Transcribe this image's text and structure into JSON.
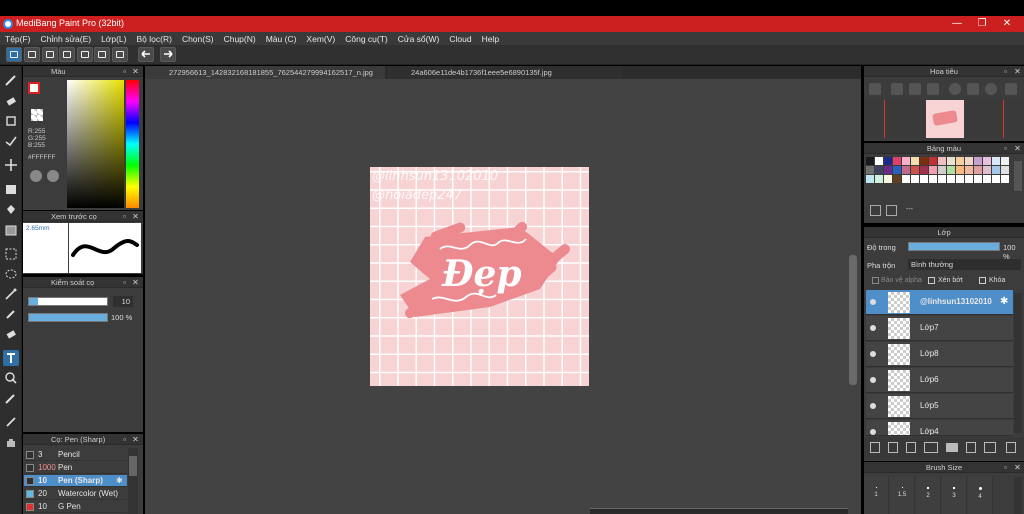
{
  "window": {
    "title": "MediBang Paint Pro (32bit)",
    "min": "—",
    "restore": "❐",
    "close": "✕"
  },
  "menu": [
    "Tệp(F)",
    "Chỉnh sửa(E)",
    "Lớp(L)",
    "Bộ lọc(R)",
    "Chọn(S)",
    "Chụp(N)",
    "Màu (C)",
    "Xem(V)",
    "Công cụ(T)",
    "Cửa sổ(W)",
    "Cloud",
    "Help"
  ],
  "tabs": [
    "272956613_1428321681818​55_762544279994162517_n.jpg",
    "24a606e11de4b1736f1eee5e6890135f.jpg"
  ],
  "color_panel": {
    "title": "Màu",
    "r": "R:255",
    "g": "G:255",
    "b": "B:255",
    "hex": "#FFFFFF"
  },
  "brush_preview": {
    "title": "Xem trước cọ",
    "size": "2.65mm"
  },
  "brush_control": {
    "title": "Kiểm soát cọ",
    "size_value": "10",
    "opacity_value": "100 %"
  },
  "brush_list": {
    "title": "Cọ: Pen (Sharp)",
    "items": [
      {
        "size": "3",
        "name": "Pencil",
        "color": "#303030"
      },
      {
        "size": "1000",
        "name": "Pen",
        "color": "#303030"
      },
      {
        "size": "10",
        "name": "Pen (Sharp)",
        "color": "#303030"
      },
      {
        "size": "20",
        "name": "Watercolor (Wet)",
        "color": "#5fb8e6"
      },
      {
        "size": "10",
        "name": "G Pen",
        "color": "#e03030"
      }
    ]
  },
  "canvas": {
    "watermark1": "@linhsun13102010",
    "watermark2": "@hoiadep247",
    "center_text": "Đẹp"
  },
  "navigator": {
    "title": "Hoa tiêu"
  },
  "palette": {
    "title": "Bảng màu",
    "label": "---",
    "colors": [
      "#1a1a1a",
      "#ffffff",
      "#1e2a8a",
      "#e0406a",
      "#f7b2c8",
      "#f2e0a8",
      "#7a3010",
      "#c03030",
      "#f0c0c0",
      "#e8e0d0",
      "#f8d0a0",
      "#f0d8c8",
      "#c8a0d0",
      "#e8c0e0",
      "#d8e8f8",
      "#f0f0f0",
      "#707070",
      "#404060",
      "#6a2a8a",
      "#2a60c0",
      "#c06a90",
      "#d05050",
      "#a03050",
      "#f0a0b0",
      "#d0d0d0",
      "#b0e0a0",
      "#f8b880",
      "#f0b8a0",
      "#e0a0a0",
      "#e0c0d0",
      "#a0c8e8",
      "#e0e0e0",
      "#c0e8f0",
      "#d0f0e0",
      "#f8f8e0",
      "#604020",
      "#ffffff",
      "#ffffff",
      "#ffffff",
      "#ffffff",
      "#ffffff",
      "#ffffff",
      "#ffffff",
      "#ffffff",
      "#ffffff",
      "#ffffff",
      "#ffffff",
      "#ffffff"
    ]
  },
  "layers_panel": {
    "title": "Lớp",
    "opacity_label": "Độ trong",
    "opacity_value": "100 %",
    "blend_label": "Pha trộn",
    "blend_value": "Bình thường",
    "protect_alpha": "Bảo vệ alpha",
    "clipping": "Xén bớt",
    "lock": "Khóa",
    "layers": [
      {
        "name": "@linhsun13102010",
        "selected": true
      },
      {
        "name": "Lớp7",
        "selected": false
      },
      {
        "name": "Lớp8",
        "selected": false
      },
      {
        "name": "Lớp6",
        "selected": false
      },
      {
        "name": "Lớp5",
        "selected": false
      },
      {
        "name": "Lớp4",
        "selected": false
      }
    ]
  },
  "brush_size_panel": {
    "title": "Brush Size",
    "sizes": [
      "1",
      "1.5",
      "2",
      "3",
      "4"
    ]
  }
}
